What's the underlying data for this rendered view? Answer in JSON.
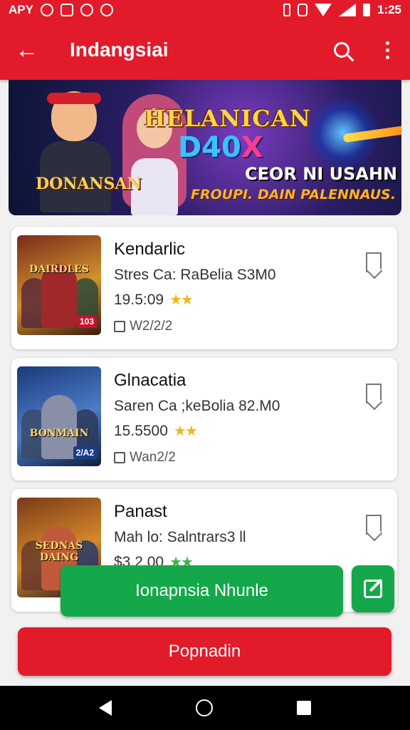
{
  "status_bar": {
    "left_text": "APY",
    "time": "1:25",
    "battery_text": "1"
  },
  "app_bar": {
    "title": "Indangsiai"
  },
  "banner": {
    "logo_line1": "HELANICAN",
    "logo_line2": "D40",
    "logo_line2_accent": "X",
    "name": "DONANSAN",
    "cta_line1": "CEOR NI USAHN",
    "cta_line2": "FROUPI. DAIN PALENNAUS."
  },
  "games": [
    {
      "name": "Kendarlic",
      "subtitle": "Stres Ca: RaBelia S3M0",
      "price": "19.5:09",
      "rating_stars": 2,
      "date": "W2/2/2",
      "thumb_label": "DAIRDLES",
      "thumb_badge": "103",
      "colors": [
        "#7a2a1c",
        "#d1932a"
      ]
    },
    {
      "name": "Glnacatia",
      "subtitle": "Saren Ca ;keBolia 82.M0",
      "price": "15.5500",
      "rating_stars": 2,
      "date": "Wan2/2",
      "thumb_label": "BONMAIN",
      "thumb_badge": "2/A2",
      "colors": [
        "#1b3a7a",
        "#4c7cc8"
      ]
    },
    {
      "name": "Panast",
      "subtitle": "Mah lo: Salntrars3 ll",
      "price": "$3.2.00",
      "rating_stars": 2,
      "date": "",
      "thumb_label": "SEDNAS DAING",
      "thumb_badge": "",
      "colors": [
        "#7a3a18",
        "#d58a2a"
      ]
    }
  ],
  "buttons": {
    "green_label": "Ionapnsia Nhunle",
    "red_label": "Popnadin"
  },
  "icons": {
    "back": "arrow-left-icon",
    "search": "search-icon",
    "more": "more-vert-icon",
    "bookmark": "bookmark-icon",
    "calendar": "calendar-icon",
    "edit": "edit-icon"
  },
  "theme": {
    "primary": "#e21b2b",
    "secondary": "#14a84a",
    "star": "#f3b614"
  }
}
